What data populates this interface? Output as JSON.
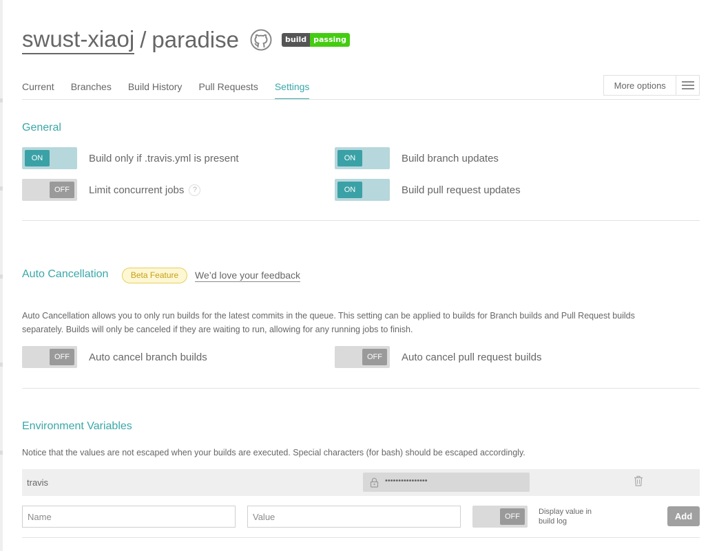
{
  "repo": {
    "owner": "swust-xiaoj",
    "separator": "/",
    "name": "paradise",
    "badge": {
      "left": "build",
      "right": "passing",
      "left_color": "#555555",
      "right_color": "#44cc11"
    }
  },
  "tabs": [
    {
      "label": "Current",
      "active": false
    },
    {
      "label": "Branches",
      "active": false
    },
    {
      "label": "Build History",
      "active": false
    },
    {
      "label": "Pull Requests",
      "active": false
    },
    {
      "label": "Settings",
      "active": true
    }
  ],
  "more_options": {
    "label": "More options",
    "icon": "hamburger-icon"
  },
  "general": {
    "title": "General",
    "settings": [
      {
        "label": "Build only if .travis.yml is present",
        "state": "ON"
      },
      {
        "label": "Build branch updates",
        "state": "ON"
      },
      {
        "label": "Limit concurrent jobs",
        "state": "OFF",
        "help": "?"
      },
      {
        "label": "Build pull request updates",
        "state": "ON"
      }
    ]
  },
  "auto_cancellation": {
    "title": "Auto Cancellation",
    "beta_label": "Beta Feature",
    "feedback_label": "We’d love your feedback",
    "description_line1": "Auto Cancellation allows you to only run builds for the latest commits in the queue. This setting can be applied to builds for Branch builds and Pull Request builds",
    "description_line2": "separately. Builds will only be canceled if they are waiting to run, allowing for any running jobs to finish.",
    "settings": [
      {
        "label": "Auto cancel branch builds",
        "state": "OFF"
      },
      {
        "label": "Auto cancel pull request builds",
        "state": "OFF"
      }
    ]
  },
  "env_vars": {
    "title": "Environment Variables",
    "notice": "Notice that the values are not escaped when your builds are executed. Special characters (for bash) should be escaped accordingly.",
    "rows": [
      {
        "name": "travis",
        "value_masked": "••••••••••••••••"
      }
    ],
    "form": {
      "name_placeholder": "Name",
      "value_placeholder": "Value",
      "display_state": "OFF",
      "display_label": "Display value in build log",
      "add_label": "Add"
    }
  },
  "colors": {
    "accent": "#39a7a8",
    "toggle_on": "#3aa1a6",
    "toggle_off": "#9a9a9a",
    "beta": "#c79f12"
  }
}
